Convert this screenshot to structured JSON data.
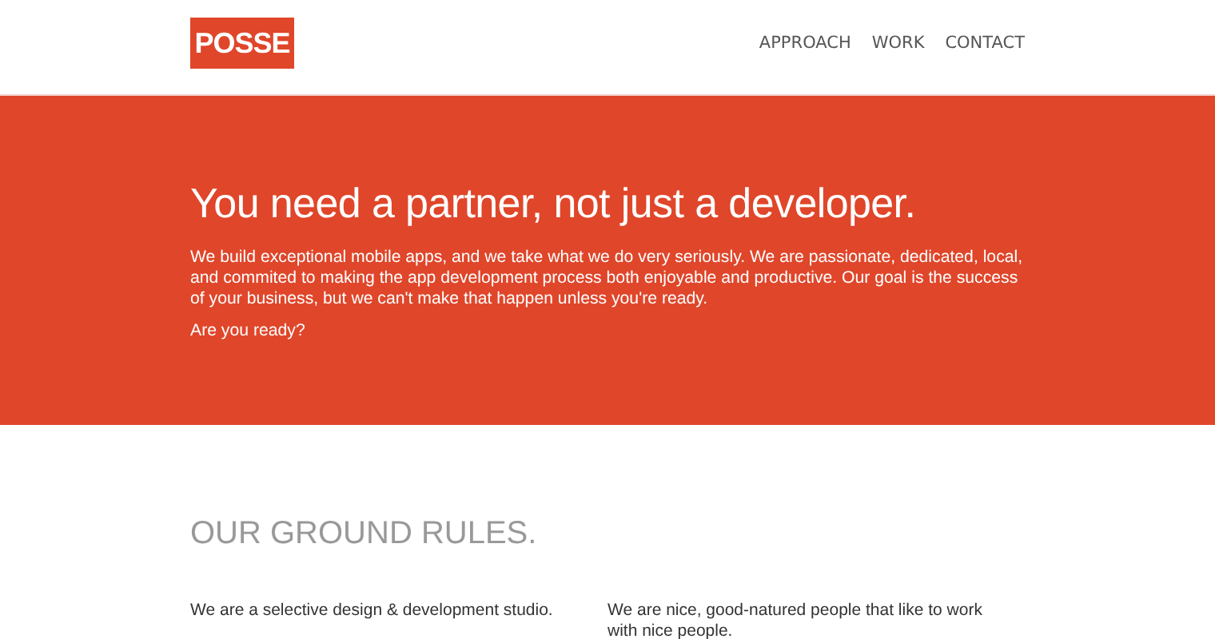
{
  "header": {
    "logo": "POSSE",
    "nav": [
      {
        "label": "APPROACH"
      },
      {
        "label": "WORK"
      },
      {
        "label": "CONTACT"
      }
    ]
  },
  "hero": {
    "title": "You need a partner, not just a developer.",
    "paragraphs": [
      "We build exceptional mobile apps, and we take what we do very seriously. We are passionate, dedicated, local, and commited to making the app development process both enjoyable and productive. Our goal is the success of your business, but we can't make that happen unless you're ready.",
      "Are you ready?"
    ]
  },
  "rules": {
    "heading": "OUR GROUND RULES.",
    "columns": [
      "We are a selective design & development studio.",
      "We are nice, good-natured people that like to work with nice people."
    ]
  }
}
